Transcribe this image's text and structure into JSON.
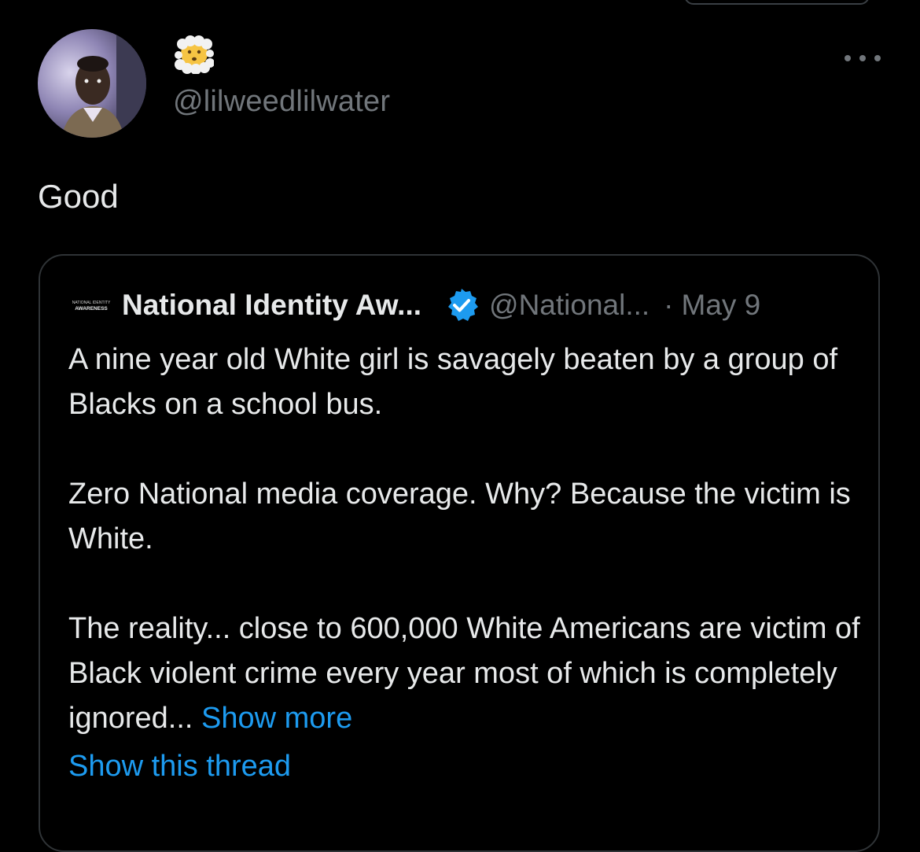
{
  "author": {
    "display_name_emoji": "face-in-clouds-emoji",
    "handle": "@lilweedlilwater",
    "avatar_icon": "avatar-photo"
  },
  "tweet": {
    "text": "Good"
  },
  "quoted_tweet": {
    "logo_lines": [
      "NATIONAL IDENTITY",
      "AWARENESS"
    ],
    "name": "National Identity Aw...",
    "handle": "@National...",
    "separator": "·",
    "date": "May 9",
    "paragraphs": [
      "A nine year old White girl is savagely beaten by a group of Blacks on a school bus.",
      "Zero National media coverage. Why? Because the victim is White.",
      "The reality... close to 600,000 White Americans are victim of Black violent crime every year most of which is completely ignored..."
    ],
    "show_more": "Show more",
    "show_thread": "Show this thread"
  },
  "colors": {
    "background": "#000000",
    "text": "#e7e9ea",
    "muted": "#71767b",
    "accent": "#1d9bf0",
    "border": "#2f3336"
  }
}
